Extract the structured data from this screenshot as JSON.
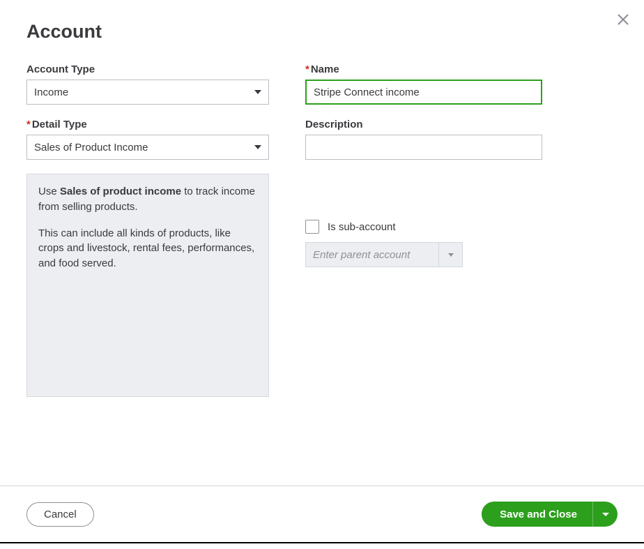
{
  "dialog": {
    "title": "Account"
  },
  "fields": {
    "account_type": {
      "label": "Account Type",
      "value": "Income"
    },
    "detail_type": {
      "label": "Detail Type",
      "value": "Sales of Product Income"
    },
    "name": {
      "label": "Name",
      "value": "Stripe Connect income"
    },
    "description": {
      "label": "Description",
      "value": ""
    },
    "sub_account": {
      "checkbox_label": "Is sub-account",
      "parent_placeholder": "Enter parent account"
    }
  },
  "explain": {
    "text_pre": "Use ",
    "bold": "Sales of product income",
    "text_post": " to track income from selling products.",
    "para2": "This can include all kinds of products, like crops and livestock, rental fees, performances, and food served."
  },
  "buttons": {
    "cancel": "Cancel",
    "save": "Save and Close"
  }
}
